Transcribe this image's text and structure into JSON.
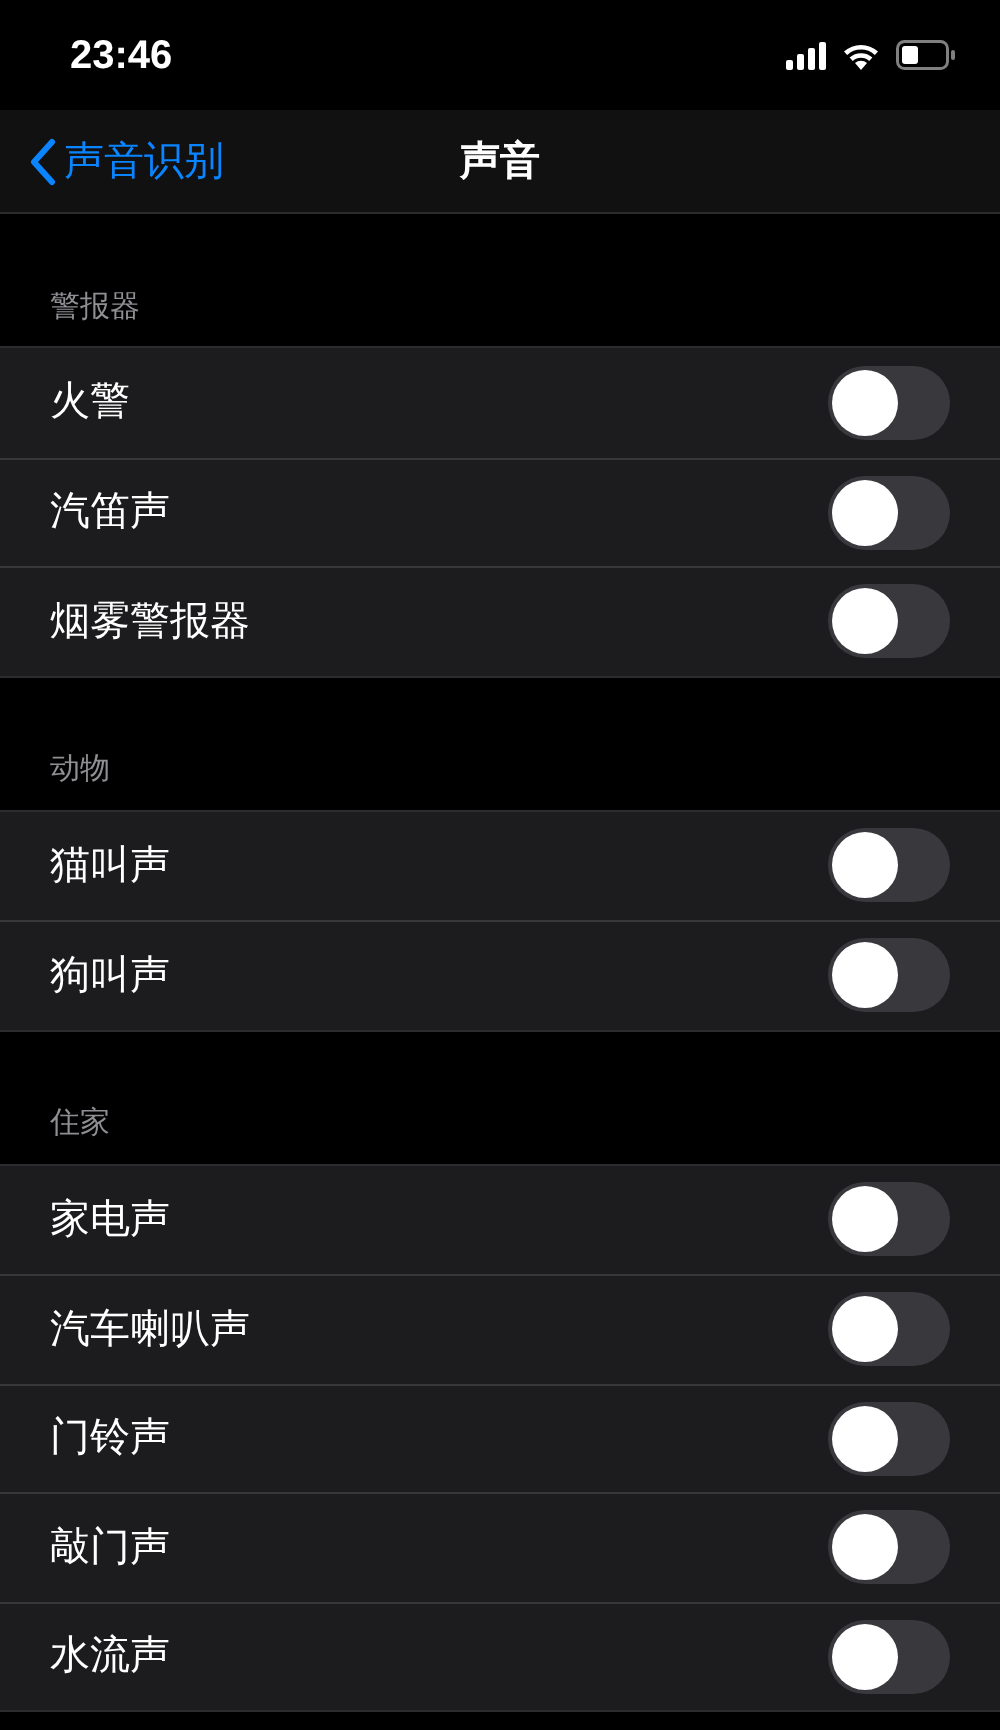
{
  "status_bar": {
    "time": "23:46"
  },
  "nav": {
    "back": "声音识别",
    "title": "声音"
  },
  "sections": [
    {
      "header": "警报器",
      "items": [
        {
          "label": "火警",
          "on": false
        },
        {
          "label": "汽笛声",
          "on": false
        },
        {
          "label": "烟雾警报器",
          "on": false
        }
      ]
    },
    {
      "header": "动物",
      "items": [
        {
          "label": "猫叫声",
          "on": false
        },
        {
          "label": "狗叫声",
          "on": false
        }
      ]
    },
    {
      "header": "住家",
      "items": [
        {
          "label": "家电声",
          "on": false
        },
        {
          "label": "汽车喇叭声",
          "on": false
        },
        {
          "label": "门铃声",
          "on": false
        },
        {
          "label": "敲门声",
          "on": false
        },
        {
          "label": "水流声",
          "on": false
        }
      ]
    }
  ]
}
